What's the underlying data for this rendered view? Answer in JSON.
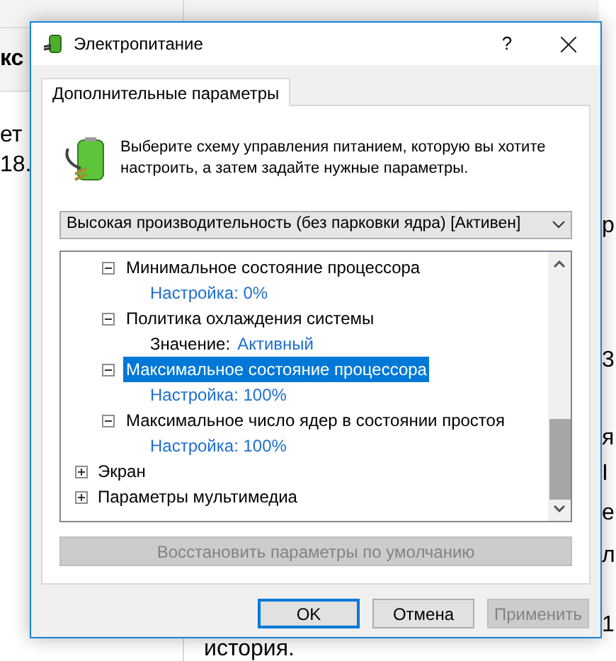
{
  "background": {
    "left_heading": "кс",
    "left_lines": [
      "ет",
      "18."
    ],
    "right_lines": [
      "р",
      "3",
      "я",
      "І",
      "е",
      "л",
      "1"
    ],
    "bottom_text": "история."
  },
  "window": {
    "title": "Электропитание",
    "help": "?"
  },
  "tabs": [
    {
      "label": "Дополнительные параметры",
      "selected": true
    }
  ],
  "description": "Выберите схему управления питанием, которую вы хотите настроить, а затем задайте нужные параметры.",
  "plan_dropdown": {
    "value": "Высокая производительность (без парковки ядра) [Активен]"
  },
  "tree": {
    "group_children": [
      {
        "label": "Минимальное состояние процессора",
        "expanded": true,
        "selected": false,
        "setting": {
          "kind": "setting",
          "label": "Настройка:",
          "value": "0%"
        }
      },
      {
        "label": "Политика охлаждения системы",
        "expanded": true,
        "selected": false,
        "setting": {
          "kind": "value",
          "label": "Значение:",
          "value": "Активный"
        }
      },
      {
        "label": "Максимальное состояние процессора",
        "expanded": true,
        "selected": true,
        "setting": {
          "kind": "setting",
          "label": "Настройка:",
          "value": "100%"
        }
      },
      {
        "label": "Максимальное число ядер в состоянии простоя",
        "expanded": true,
        "selected": false,
        "setting": {
          "kind": "setting",
          "label": "Настройка:",
          "value": "100%"
        }
      }
    ],
    "items": [
      {
        "label": "Экран",
        "expanded": false,
        "selected": false
      },
      {
        "label": "Параметры мультимедиа",
        "expanded": false,
        "selected": false
      }
    ]
  },
  "restore_button": {
    "label": "Восстановить параметры по умолчанию",
    "disabled": true
  },
  "buttons": [
    {
      "label": "OK",
      "default": true,
      "disabled": false
    },
    {
      "label": "Отмена",
      "default": false,
      "disabled": false
    },
    {
      "label": "Применить",
      "default": false,
      "disabled": true
    }
  ]
}
